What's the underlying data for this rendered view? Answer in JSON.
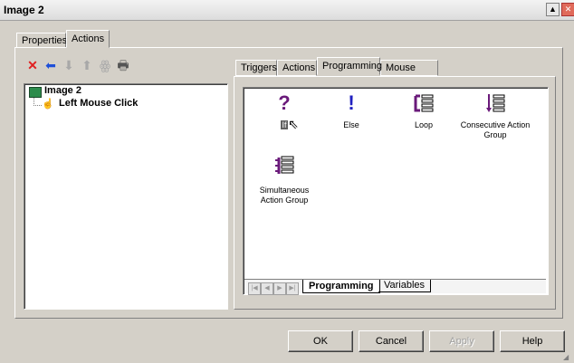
{
  "window": {
    "title": "Image 2",
    "min_glyph": "▲",
    "close_glyph": "✕"
  },
  "outer_tabs": [
    {
      "label": "Properties"
    },
    {
      "label": "Actions"
    }
  ],
  "toolbar": {
    "delete_glyph": "✕",
    "back_glyph": "⬅",
    "down_glyph": "⬇",
    "up_glyph": "⬆",
    "group_glyph": "ꙮ",
    "print_glyph": "🖶"
  },
  "tree": {
    "root_label": "Image 2",
    "child_label": "Left Mouse Click"
  },
  "inner_tabs": [
    {
      "label": "Triggers"
    },
    {
      "label": "Actions"
    },
    {
      "label": "Programming"
    },
    {
      "label": "Mouse Click"
    }
  ],
  "palette": [
    {
      "label": "If"
    },
    {
      "label": "Else"
    },
    {
      "label": "Loop"
    },
    {
      "label": "Consecutive Action Group"
    },
    {
      "label": "Simultaneous Action Group"
    }
  ],
  "sheet_tabs": [
    {
      "label": "Programming"
    },
    {
      "label": "Variables"
    }
  ],
  "buttons": {
    "ok": "OK",
    "cancel": "Cancel",
    "apply": "Apply",
    "help": "Help"
  },
  "colors": {
    "delete": "#e02020",
    "arrow": "#1e4fd8",
    "purple": "#6a1a7a",
    "blue": "#2020c0"
  }
}
